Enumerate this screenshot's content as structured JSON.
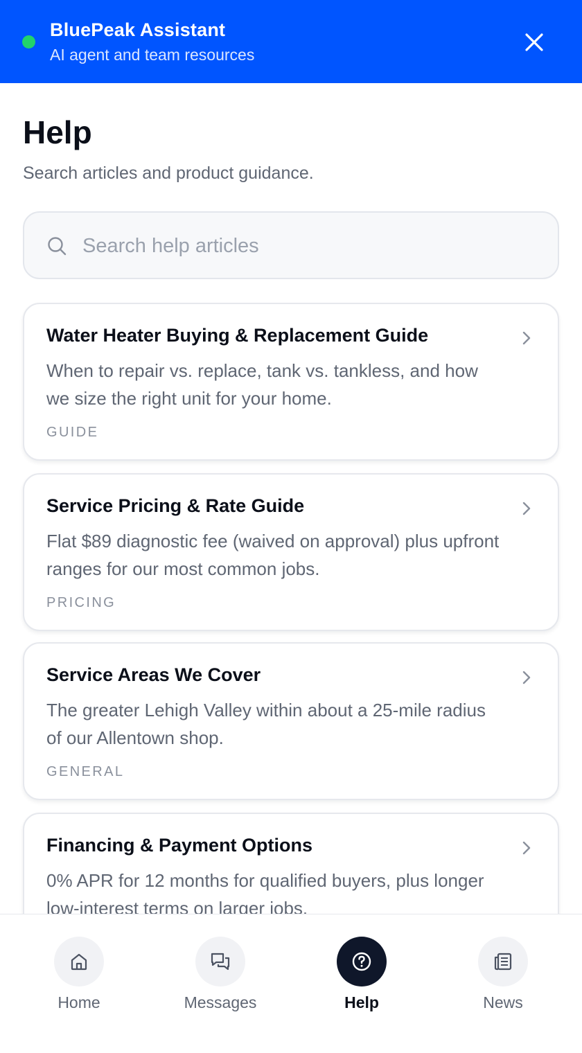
{
  "header": {
    "title": "BluePeak Assistant",
    "subtitle": "AI agent and team resources",
    "status_color": "#22d36b",
    "close_icon": "close-icon",
    "background": "#0055ff"
  },
  "page": {
    "title": "Help",
    "subtitle": "Search articles and product guidance."
  },
  "search": {
    "placeholder": "Search help articles",
    "value": "",
    "icon": "search-icon"
  },
  "articles": [
    {
      "title": "Water Heater Buying & Replacement Guide",
      "description": "When to repair vs. replace, tank vs. tankless, and how we size the right unit for your home.",
      "tag": "GUIDE"
    },
    {
      "title": "Service Pricing & Rate Guide",
      "description": "Flat $89 diagnostic fee (waived on approval) plus upfront ranges for our most common jobs.",
      "tag": "PRICING"
    },
    {
      "title": "Service Areas We Cover",
      "description": "The greater Lehigh Valley within about a 25-mile radius of our Allentown shop.",
      "tag": "GENERAL"
    },
    {
      "title": "Financing & Payment Options",
      "description": "0% APR for 12 months for qualified buyers, plus longer low-interest terms on larger jobs.",
      "tag": ""
    }
  ],
  "nav": {
    "items": [
      {
        "label": "Home",
        "icon": "home-icon",
        "active": false
      },
      {
        "label": "Messages",
        "icon": "messages-icon",
        "active": false
      },
      {
        "label": "Help",
        "icon": "help-icon",
        "active": true
      },
      {
        "label": "News",
        "icon": "news-icon",
        "active": false
      }
    ]
  }
}
